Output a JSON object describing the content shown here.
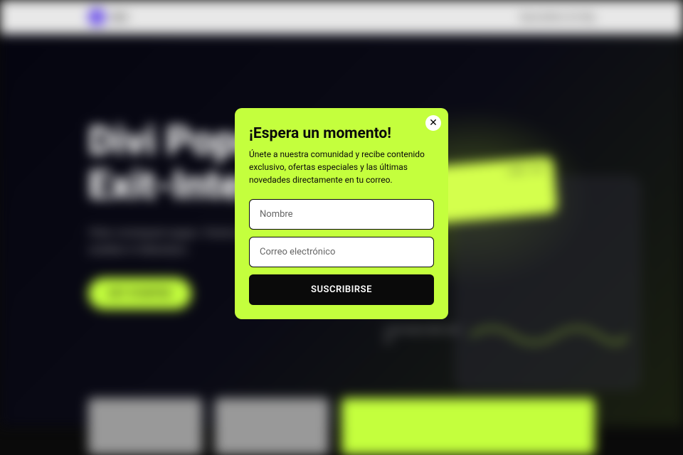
{
  "topbar": {
    "logo_text": "divi",
    "right_text": "Specialties Go Big"
  },
  "hero": {
    "title_line1": "Divi Popup",
    "title_line2": "Exit-Intent",
    "subtitle": "Vitas consequat augue. Viverra aptent condimentum sodales in bibendum.",
    "cta_label": "GET STARTED",
    "card_pill_a": "LOREM",
    "card_pill_b": "NEW",
    "side_text": "Lorem ipsum dolor amet sit"
  },
  "modal": {
    "title": "¡Espera un momento!",
    "description": "Únete a nuestra comunidad y recibe contenido exclusivo, ofertas especiales y las últimas novedades directamente en tu correo.",
    "name_placeholder": "Nombre",
    "email_placeholder": "Correo electrónico",
    "submit_label": "SUSCRIBIRSE",
    "close_glyph": "✕"
  }
}
